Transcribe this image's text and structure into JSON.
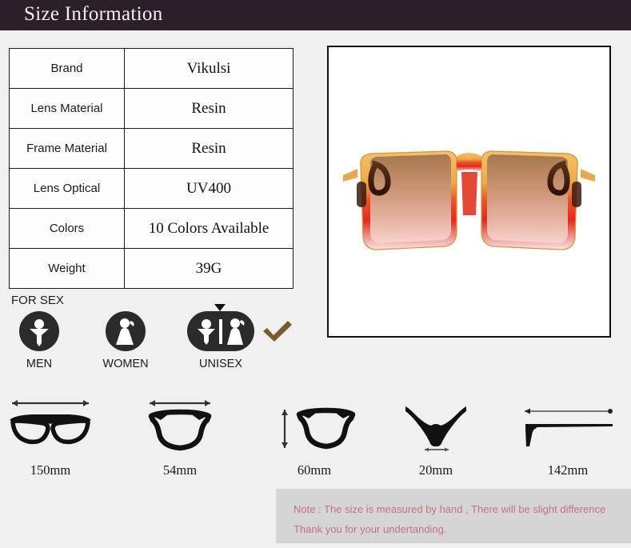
{
  "header": {
    "title": "Size Information"
  },
  "spec_table": {
    "rows": [
      {
        "label": "Brand",
        "value": "Vikulsi"
      },
      {
        "label": "Lens Material",
        "value": "Resin"
      },
      {
        "label": "Frame Material",
        "value": "Resin"
      },
      {
        "label": "Lens Optical",
        "value": "UV400"
      },
      {
        "label": "Colors",
        "value": "10 Colors Available"
      },
      {
        "label": "Weight",
        "value": "39G"
      }
    ]
  },
  "product_image": {
    "alt": "oversized square sunglasses with amber to red gradient frame and brown to pink gradient lenses",
    "frame_top_color": "#f0b95c",
    "frame_mid_color": "#e5372a",
    "frame_bottom_color": "#f5e3e0",
    "lens_top_color": "#a9764f",
    "lens_bottom_color": "#f6cdc7",
    "hinge_color": "#3a1f12",
    "background": "#ffffff"
  },
  "for_sex": {
    "label": "FOR SEX",
    "options": [
      {
        "caption": "MEN",
        "icon": "male-figure-icon",
        "selected": false
      },
      {
        "caption": "WOMEN",
        "icon": "female-figure-icon",
        "selected": false
      },
      {
        "caption": "UNISEX",
        "icon": "unisex-figures-icon",
        "selected": true
      }
    ],
    "selected": "UNISEX",
    "check_color": "#7a5a2e",
    "icon_color": "#2b2b2b"
  },
  "measurements": [
    {
      "value": "150mm",
      "icon": "glasses-front-width-icon",
      "description": "total frame width"
    },
    {
      "value": "54mm",
      "icon": "lens-width-icon",
      "description": "lens width"
    },
    {
      "value": "60mm",
      "icon": "lens-height-icon",
      "description": "lens height"
    },
    {
      "value": "20mm",
      "icon": "bridge-width-icon",
      "description": "bridge width"
    },
    {
      "value": "142mm",
      "icon": "temple-length-icon",
      "description": "temple arm length"
    }
  ],
  "note": {
    "line1": "Note : The size is measured by hand , There will be slight difference",
    "line2": "Thank you for your undertanding.",
    "text_color": "#c4737d",
    "background": "#d5d5d5"
  }
}
